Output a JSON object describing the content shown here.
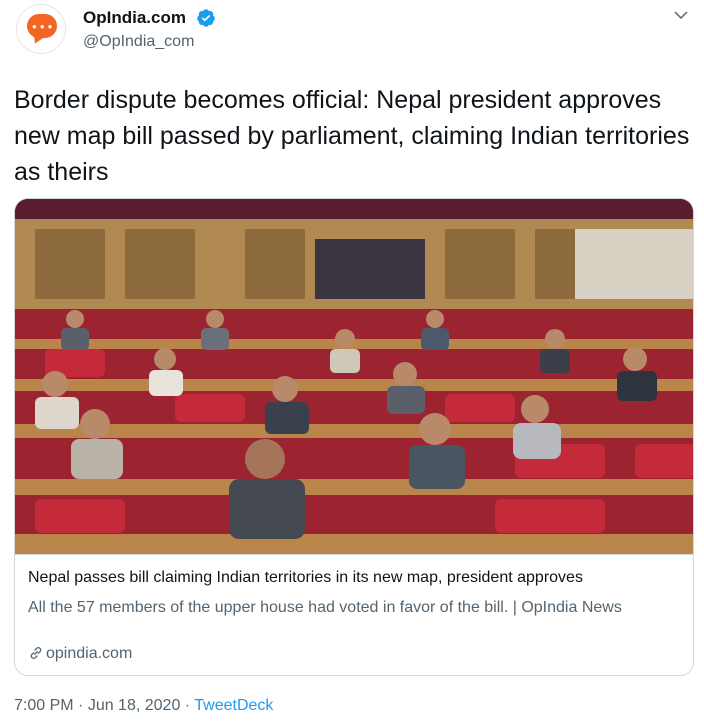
{
  "author": {
    "name": "OpIndia.com",
    "handle": "@OpIndia_com"
  },
  "tweet": {
    "text": "Border dispute becomes official: Nepal president approves new map bill passed by parliament, claiming Indian territories as theirs"
  },
  "card": {
    "title": "Nepal passes bill claiming Indian territories in its new map, president approves",
    "description": "All the 57 members of the upper house had voted in favor of the bill. | OpIndia News",
    "domain": "opindia.com"
  },
  "meta": {
    "time": "7:00 PM",
    "separator1": " · ",
    "date": "Jun 18, 2020",
    "separator2": " · ",
    "app": "TweetDeck"
  },
  "colors": {
    "accent": "#1d9bf0",
    "brand": "#f26522",
    "text": "#0f1419",
    "muted": "#536471"
  },
  "icons": [
    "opindia-logo",
    "verified-badge-icon",
    "chevron-down-icon",
    "link-icon"
  ]
}
